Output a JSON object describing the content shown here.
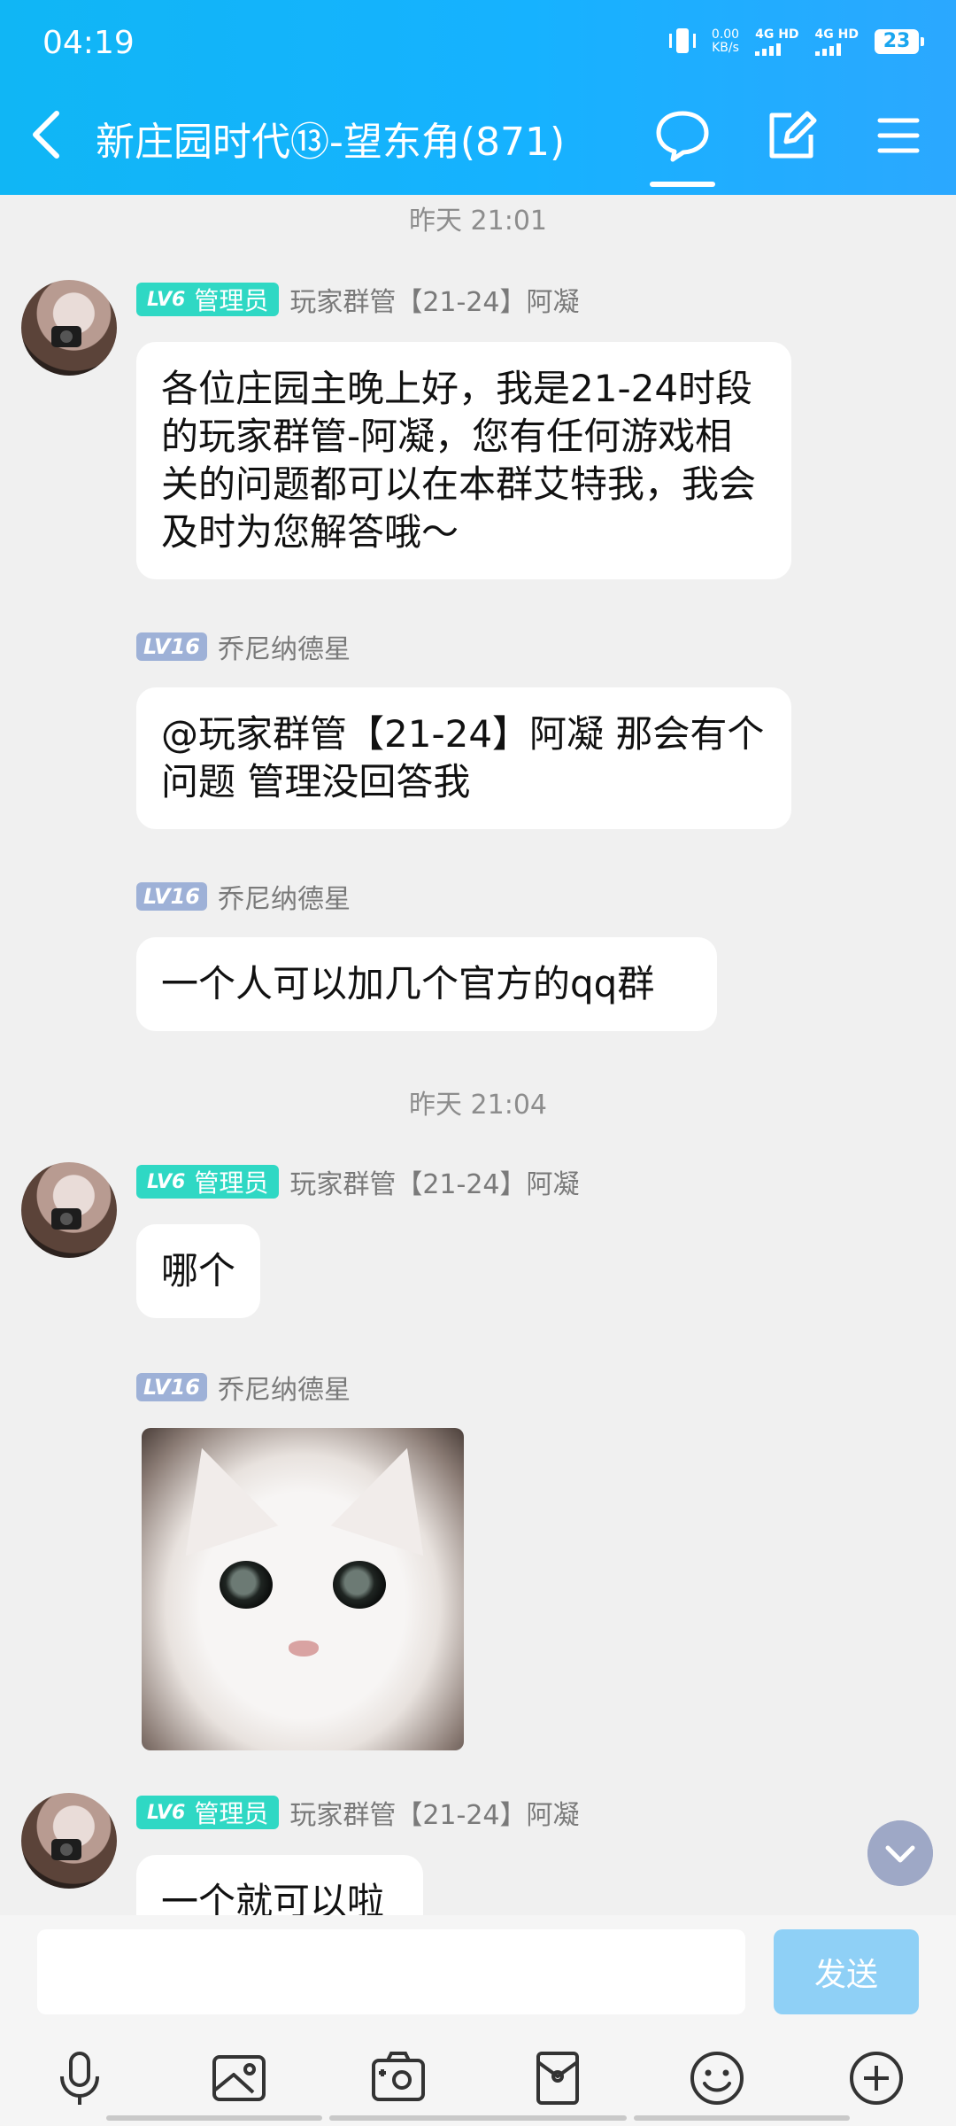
{
  "status_bar": {
    "time": "04:19",
    "net_speed_value": "0.00",
    "net_speed_unit": "KB/s",
    "sim1_label": "4G HD",
    "sim2_label": "4G HD",
    "battery": "23"
  },
  "header": {
    "title": "新庄园时代⑬-望东角(871)",
    "active_tab": "chat",
    "accent_color": "#16b2ff"
  },
  "messages": [
    {
      "type": "timestamp",
      "text": "昨天 21:01"
    },
    {
      "type": "message",
      "sender": "玩家群管【21-24】阿凝",
      "badge_level": "LV6",
      "badge_role": "管理员",
      "text": "各位庄园主晚上好，我是21-24时段的玩家群管-阿凝，您有任何游戏相关的问题都可以在本群艾特我，我会及时为您解答哦～"
    },
    {
      "type": "message",
      "sender": "乔尼纳德星",
      "badge_level": "LV16",
      "text": "@玩家群管【21-24】阿凝 那会有个问题 管理没回答我"
    },
    {
      "type": "message",
      "sender": "乔尼纳德星",
      "badge_level": "LV16",
      "text": "一个人可以加几个官方的qq群"
    },
    {
      "type": "timestamp",
      "text": "昨天 21:04"
    },
    {
      "type": "message",
      "sender": "玩家群管【21-24】阿凝",
      "badge_level": "LV6",
      "badge_role": "管理员",
      "text": "哪个"
    },
    {
      "type": "image",
      "sender": "乔尼纳德星",
      "badge_level": "LV16",
      "image": "white-cat-photo"
    },
    {
      "type": "message",
      "sender": "玩家群管【21-24】阿凝",
      "badge_level": "LV6",
      "badge_role": "管理员",
      "text": "一个就可以啦"
    }
  ],
  "input": {
    "value": "",
    "send_label": "发送"
  },
  "toolbar": [
    "voice-icon",
    "photo-icon",
    "camera-icon",
    "red-packet-icon",
    "emoji-icon",
    "plus-icon"
  ]
}
